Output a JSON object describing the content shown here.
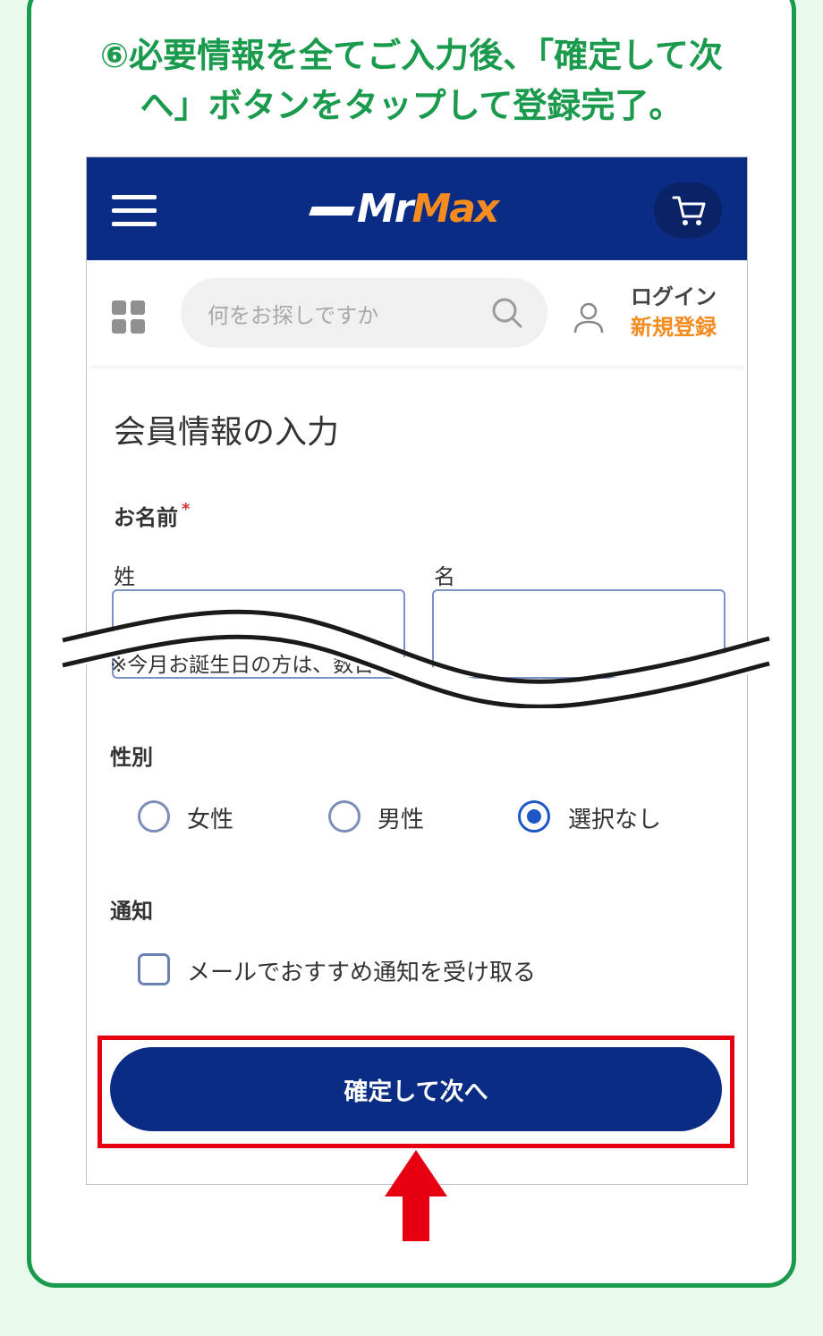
{
  "instruction": {
    "line1": "⑥必要情報を全てご入力後、「確定して次",
    "line2": "へ」ボタンをタップして登録完了。"
  },
  "header": {
    "logo_mr": "Mr",
    "logo_max": "Max",
    "brand_colors": {
      "navy": "#0b2c84",
      "orange": "#f68b1f"
    },
    "menu_icon": "hamburger-icon",
    "cart_icon": "cart-icon"
  },
  "search": {
    "placeholder": "何をお探しですか",
    "menu_icon": "grid-icon",
    "search_icon": "search-icon",
    "user_icon": "user-icon",
    "login_label": "ログイン",
    "signup_label": "新規登録"
  },
  "form": {
    "title": "会員情報の入力",
    "name_label": "お名前",
    "required_mark": "*",
    "last_name_label": "姓",
    "first_name_label": "名",
    "birthday_note": "※今月お誕生日の方は、数日",
    "gender_label": "性別",
    "gender_options": [
      "女性",
      "男性",
      "選択なし"
    ],
    "gender_selected": "選択なし",
    "notify_label": "通知",
    "notify_checkbox_label": "メールでおすすめ通知を受け取る",
    "notify_checked": false,
    "submit_label": "確定して次へ"
  },
  "colors": {
    "accent_green": "#1a9a4c",
    "highlight_red": "#e60012",
    "radio_blue": "#1e56c7"
  }
}
